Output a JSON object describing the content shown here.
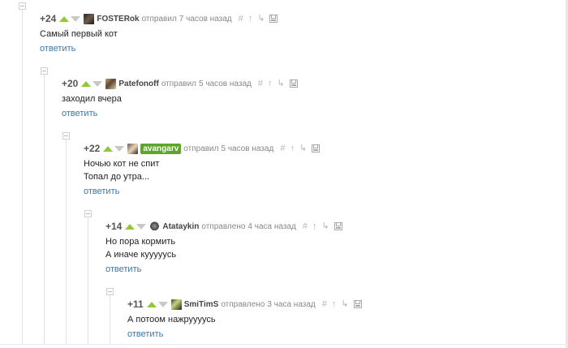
{
  "comments": [
    {
      "rating": "+24",
      "username": "FOSTERok",
      "action": "отправил",
      "time": "7 часов назад",
      "lines": [
        "Самый первый кот"
      ],
      "reply_label": "ответить"
    },
    {
      "rating": "+20",
      "username": "Patefonoff",
      "action": "отправил",
      "time": "5 часов назад",
      "lines": [
        "заходил вчера"
      ],
      "reply_label": "ответить"
    },
    {
      "rating": "+22",
      "username": "avangarv",
      "action": "отправил",
      "time": "5 часов назад",
      "lines": [
        "Ночью кот не спит",
        "Топал до утра..."
      ],
      "reply_label": "ответить"
    },
    {
      "rating": "+14",
      "username": "Atataykin",
      "action": "отправлено",
      "time": "4 часа назад",
      "lines": [
        "Но пора кормить",
        "А иначе куууууcь"
      ],
      "reply_label": "ответить"
    },
    {
      "rating": "+11",
      "username": "SmiTimS",
      "action": "отправлено",
      "time": "3 часа назад",
      "lines": [
        "А потоом нажруууусь"
      ],
      "reply_label": "ответить"
    }
  ],
  "tools": {
    "link": "#",
    "up": "↑",
    "branch": "↳"
  },
  "colors": {
    "vote_up": "#8fc93a",
    "vote_down": "#c8c8c8",
    "highlight_user": "#5aa72a",
    "reply_link": "#3a78ab"
  }
}
